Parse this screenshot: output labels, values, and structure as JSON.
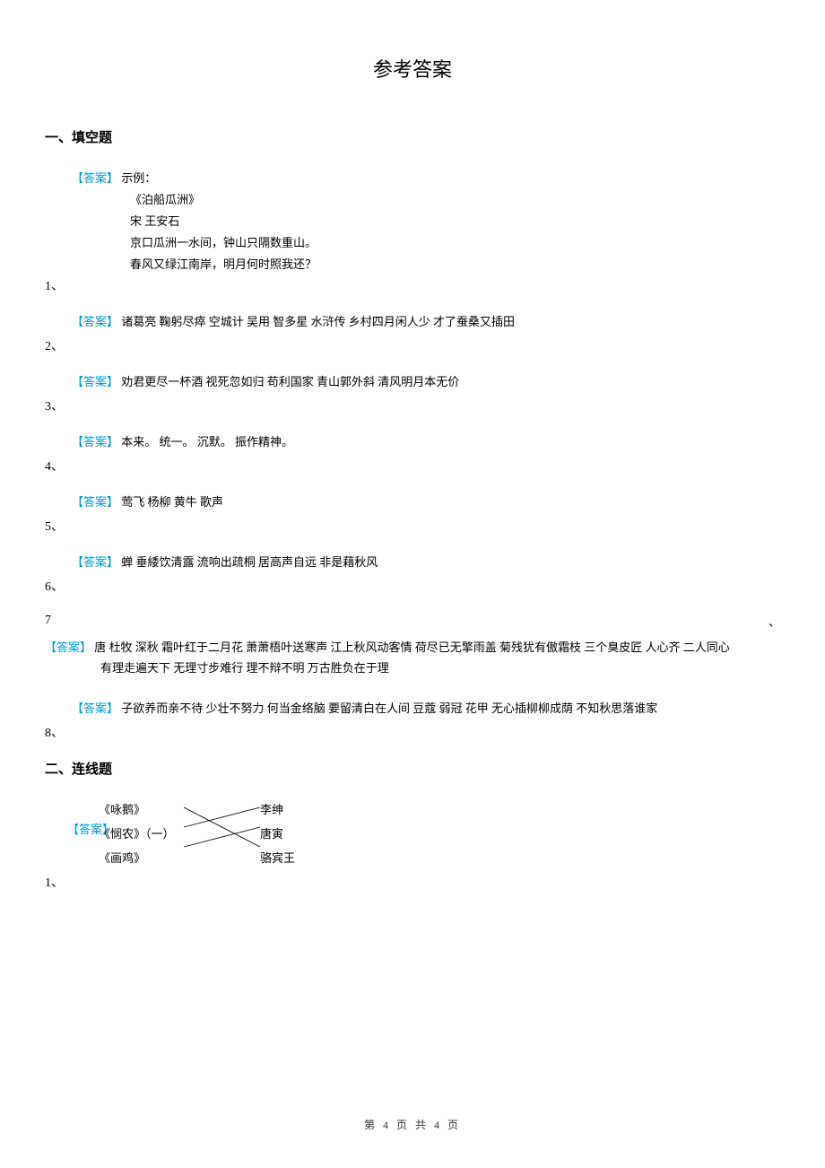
{
  "title": "参考答案",
  "section1_heading": "一、填空题",
  "section2_heading": "二、连线题",
  "answer_label": "【答案】",
  "items": {
    "i1": {
      "num": "1、",
      "l1": "示例：",
      "l2": "《泊船瓜洲》",
      "l3": "宋 王安石",
      "l4": "京口瓜洲一水间，钟山只隔数重山。",
      "l5": "春风又绿江南岸，明月何时照我还？"
    },
    "i2": {
      "num": "2、",
      "text": "诸葛亮 鞠躬尽瘁 空城计 吴用 智多星 水浒传 乡村四月闲人少 才了蚕桑又插田"
    },
    "i3": {
      "num": "3、",
      "text": "劝君更尽一杯酒 视死忽如归 苟利国家 青山郭外斜 清风明月本无价"
    },
    "i4": {
      "num": "4、",
      "text": "本来。 统一。 沉默。 振作精神。"
    },
    "i5": {
      "num": "5、",
      "text": "莺飞 杨柳 黄牛 歌声"
    },
    "i6": {
      "num": "6、",
      "text": "蝉 垂緌饮清露 流响出疏桐 居高声自远 非是藉秋风"
    },
    "i7": {
      "num": "7",
      "dot": "、",
      "line1": "唐 杜牧 深秋 霜叶红于二月花 萧萧梧叶送寒声 江上秋风动客情 荷尽已无擎雨盖 菊残犹有傲霜枝 三个臭皮匠 人心齐 二人同心",
      "line2": "有理走遍天下 无理寸步难行 理不辩不明 万古胜负在于理"
    },
    "i8": {
      "num": "8、",
      "text": "子欲养而亲不待 少壮不努力 何当金络脑 要留清白在人间 豆蔻 弱冠 花甲 无心插柳柳成荫 不知秋思落谁家"
    }
  },
  "matching": {
    "num": "1、",
    "left": [
      "《咏鹅》",
      "《悯农》（一）",
      "《画鸡》"
    ],
    "right": [
      "李绅",
      "唐寅",
      "骆宾王"
    ]
  },
  "footer": "第 4 页 共 4 页"
}
